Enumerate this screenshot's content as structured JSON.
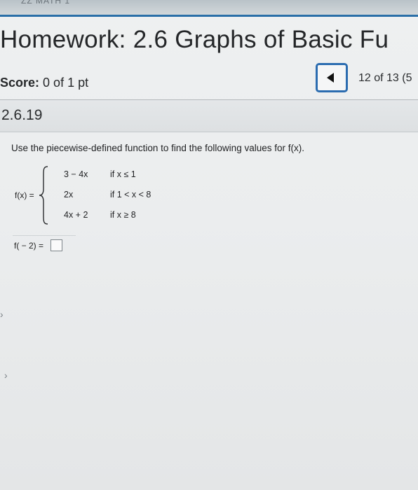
{
  "header": {
    "cut_text": "ZZ MATH 1",
    "title": "Homework: 2.6 Graphs of Basic Fu"
  },
  "score": {
    "label": "Score:",
    "value": "0 of 1 pt"
  },
  "nav": {
    "counter": "12 of 13 (5"
  },
  "problem": {
    "number": "2.6.19",
    "instruction": "Use the piecewise-defined function to find the following values for f(x).",
    "function_label": "f(x) =",
    "cases": [
      {
        "expr": "3 − 4x",
        "cond": "if  x ≤ 1"
      },
      {
        "expr": "2x",
        "cond": "if  1 < x < 8"
      },
      {
        "expr": "4x + 2",
        "cond": "if  x ≥ 8"
      }
    ],
    "answer_label": "f( − 2) ="
  }
}
